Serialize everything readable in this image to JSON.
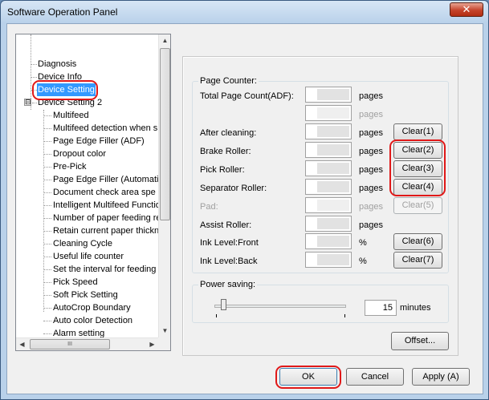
{
  "window": {
    "title": "Software Operation Panel",
    "close_glyph": "✕"
  },
  "tree": {
    "items": [
      {
        "label": "Diagnosis"
      },
      {
        "label": "Device Info"
      },
      {
        "label": "Device Setting"
      },
      {
        "label": "Device Setting 2",
        "expander": "⊟"
      },
      {
        "label": "Multifeed"
      },
      {
        "label": "Multifeed detection when s"
      },
      {
        "label": "Page Edge Filler (ADF)"
      },
      {
        "label": "Dropout color"
      },
      {
        "label": "Pre-Pick"
      },
      {
        "label": "Page Edge Filler (Automatio"
      },
      {
        "label": "Document check area spe"
      },
      {
        "label": "Intelligent Multifeed Functio"
      },
      {
        "label": "Number of paper feeding re"
      },
      {
        "label": "Retain current paper thickn"
      },
      {
        "label": "Cleaning Cycle"
      },
      {
        "label": "Useful life counter"
      },
      {
        "label": "Set the interval for feeding"
      },
      {
        "label": "Pick Speed"
      },
      {
        "label": "Soft Pick Setting"
      },
      {
        "label": "AutoCrop Boundary"
      },
      {
        "label": "Auto color Detection"
      },
      {
        "label": "Alarm setting"
      }
    ],
    "scroll_up": "▲",
    "scroll_down": "▼",
    "scroll_left": "◀",
    "scroll_right": "▶",
    "hthumb_grip": "III"
  },
  "page_counter": {
    "title": "Page Counter:",
    "rows": [
      {
        "label": "Total Page Count(ADF):",
        "unit": "pages"
      },
      {
        "label": "",
        "unit": "pages"
      },
      {
        "label": "After cleaning:",
        "unit": "pages",
        "button": "Clear(1)"
      },
      {
        "label": "Brake Roller:",
        "unit": "pages",
        "button": "Clear(2)"
      },
      {
        "label": "Pick Roller:",
        "unit": "pages",
        "button": "Clear(3)"
      },
      {
        "label": "Separator Roller:",
        "unit": "pages",
        "button": "Clear(4)"
      },
      {
        "label": "Pad:",
        "unit": "pages",
        "button": "Clear(5)"
      },
      {
        "label": "Assist Roller:",
        "unit": "pages"
      },
      {
        "label": "Ink Level:Front",
        "unit": "%",
        "button": "Clear(6)"
      },
      {
        "label": "Ink Level:Back",
        "unit": "%",
        "button": "Clear(7)"
      }
    ]
  },
  "power_saving": {
    "title": "Power saving:",
    "value": "15",
    "level": 0.05,
    "unit": "minutes"
  },
  "buttons": {
    "offset": "Offset...",
    "ok": "OK",
    "cancel": "Cancel",
    "apply": "Apply (A)"
  },
  "colors": {
    "selection": "#3399ff",
    "highlight_ring": "#e01818",
    "title_close": "#c5432a"
  }
}
